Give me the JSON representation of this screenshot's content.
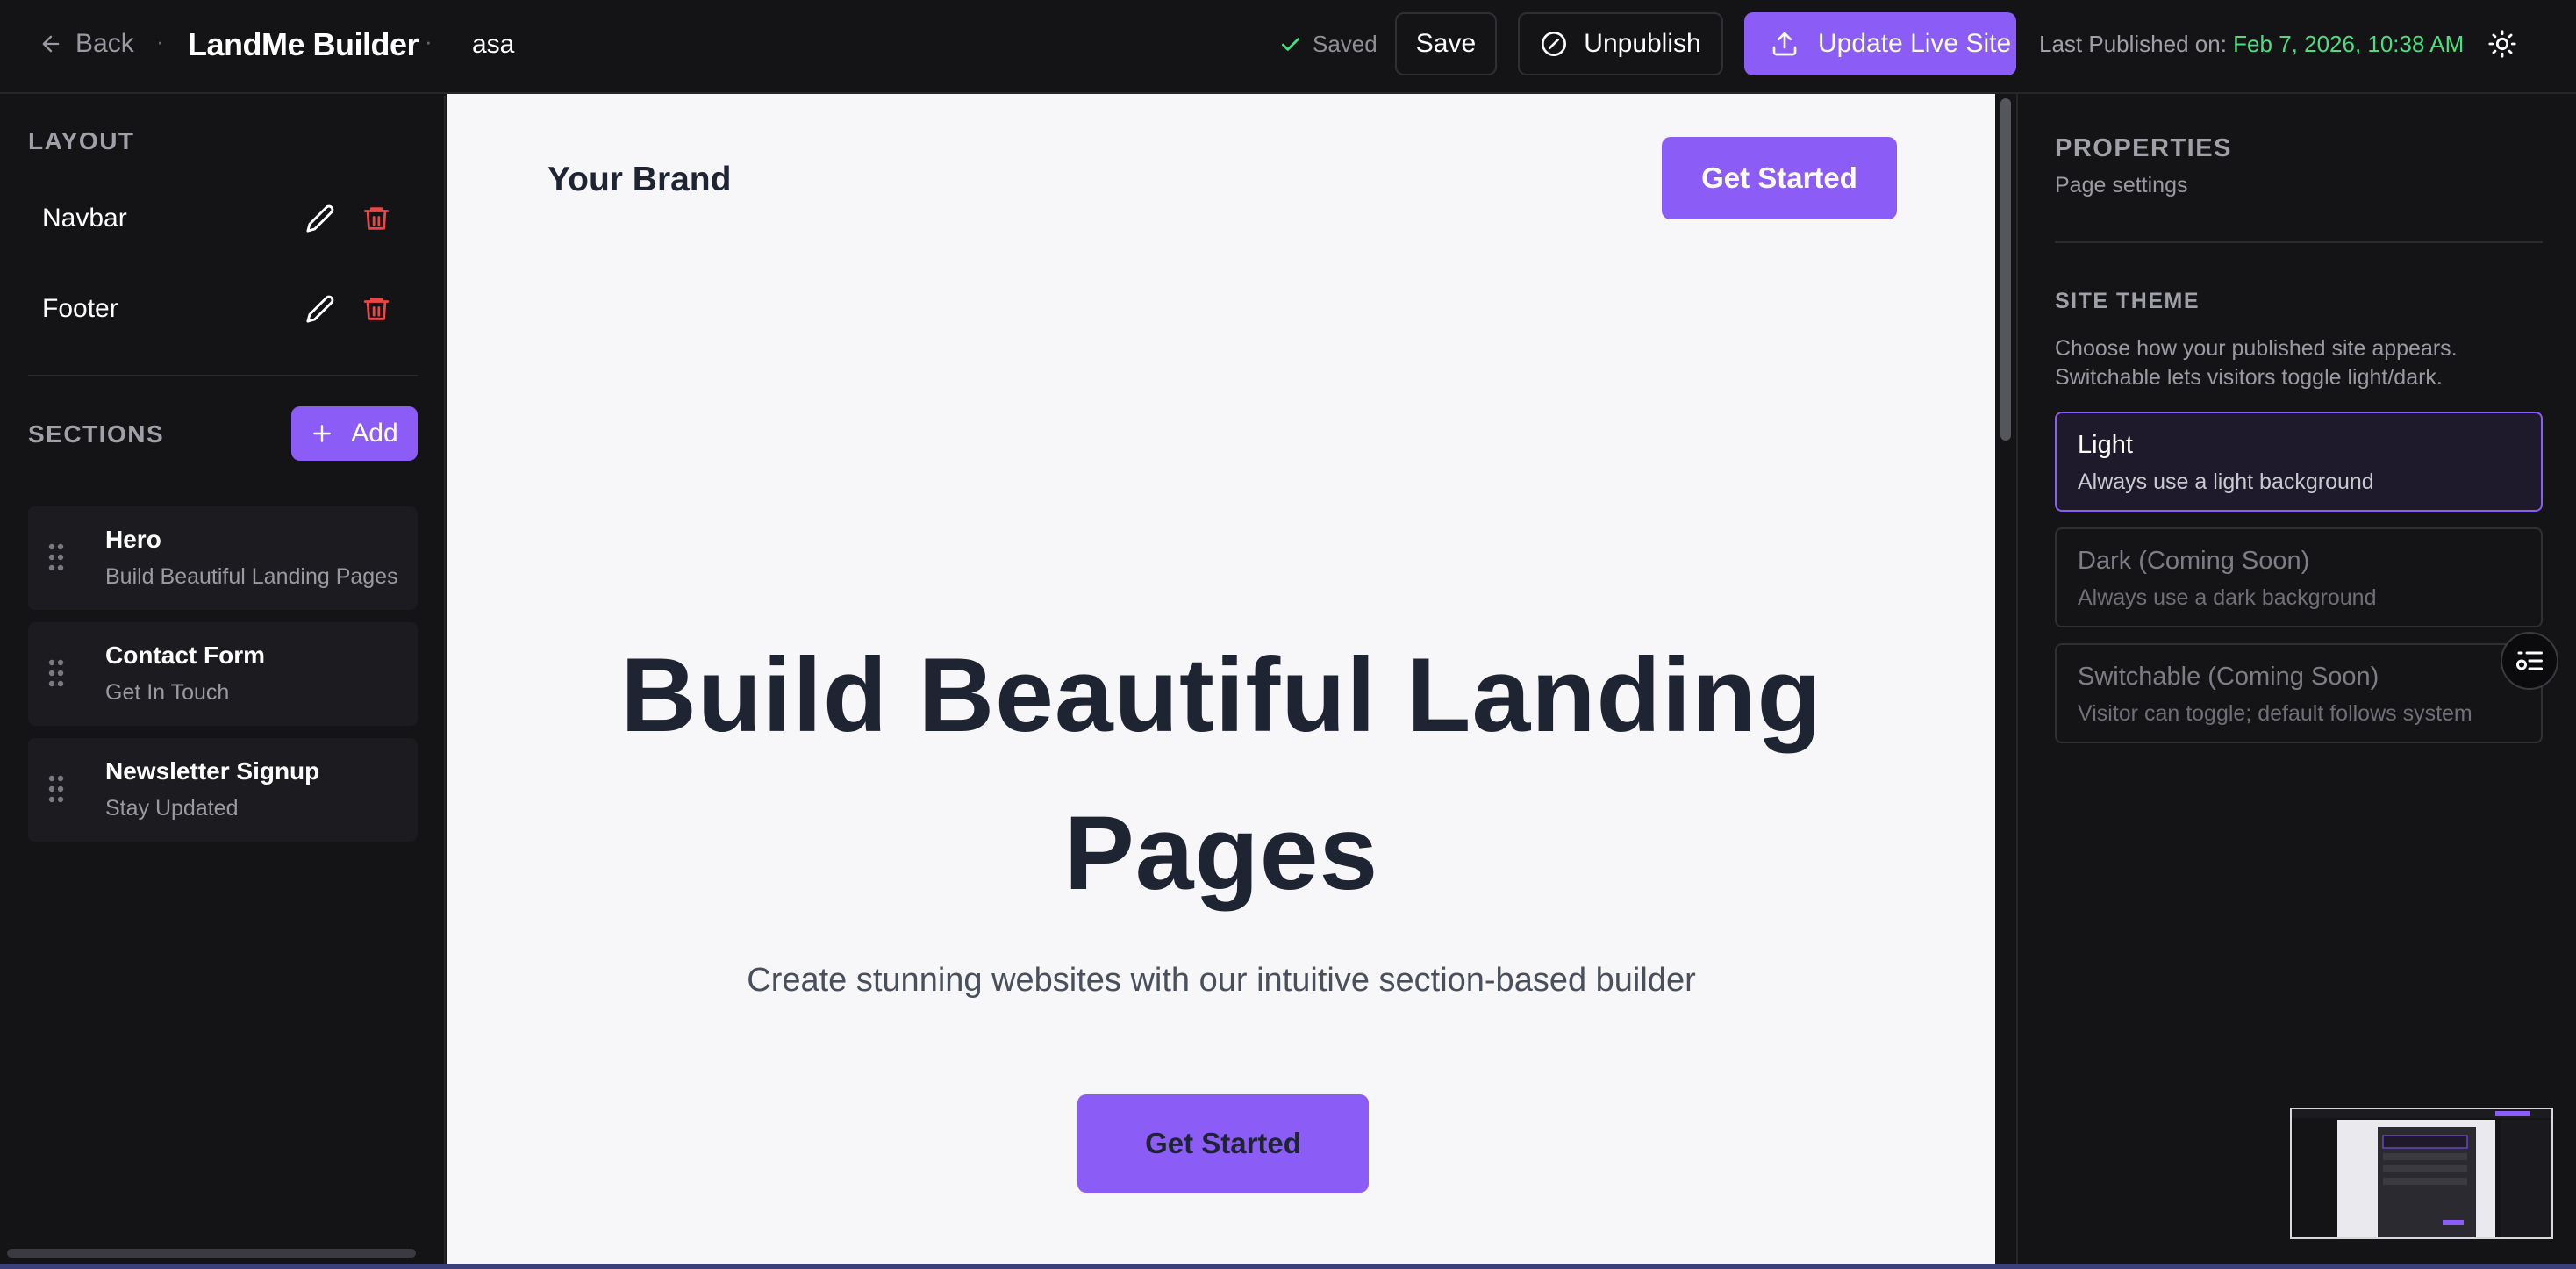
{
  "topbar": {
    "back_label": "Back",
    "app_title": "LandMe Builder",
    "separator": "·",
    "page_slug": "asa",
    "saved_label": "Saved",
    "save_label": "Save",
    "unpublish_label": "Unpublish",
    "update_live_label": "Update Live Site",
    "last_published_label": "Last Published on:",
    "last_published_date": "Feb 7, 2026, 10:38 AM"
  },
  "left_panel": {
    "layout_heading": "LAYOUT",
    "layout_items": [
      {
        "label": "Navbar"
      },
      {
        "label": "Footer"
      }
    ],
    "sections_heading": "SECTIONS",
    "add_label": "Add",
    "sections": [
      {
        "title": "Hero",
        "subtitle": "Build Beautiful Landing Pages"
      },
      {
        "title": "Contact Form",
        "subtitle": "Get In Touch"
      },
      {
        "title": "Newsletter Signup",
        "subtitle": "Stay Updated"
      }
    ]
  },
  "preview": {
    "brand": "Your Brand",
    "nav_cta": "Get Started",
    "hero_title": "Build Beautiful Landing Pages",
    "hero_subtitle": "Create stunning websites with our intuitive section-based builder",
    "hero_cta": "Get Started"
  },
  "right_panel": {
    "properties_heading": "PROPERTIES",
    "properties_sub": "Page settings",
    "site_theme_heading": "SITE THEME",
    "site_theme_desc": "Choose how your published site appears. Switchable lets visitors toggle light/dark.",
    "theme_options": [
      {
        "title": "Light",
        "desc": "Always use a light background",
        "selected": true
      },
      {
        "title": "Dark (Coming Soon)",
        "desc": "Always use a dark background",
        "selected": false
      },
      {
        "title": "Switchable (Coming Soon)",
        "desc": "Visitor can toggle; default follows system",
        "selected": false
      }
    ]
  },
  "icons": {
    "back": "arrow-left-icon",
    "saved": "check-icon",
    "unpublish": "circle-slash-icon",
    "update_live": "upload-icon",
    "theme": "sun-icon",
    "edit": "pencil-icon",
    "delete": "trash-icon",
    "add": "plus-icon",
    "drag": "grip-vertical-icon",
    "floating": "list-settings-icon"
  },
  "colors": {
    "accent": "#8b5cf6",
    "published_date": "#4ade80",
    "delete_icon": "#ef4444",
    "background": "#121215",
    "preview_background": "#f7f7f9"
  }
}
